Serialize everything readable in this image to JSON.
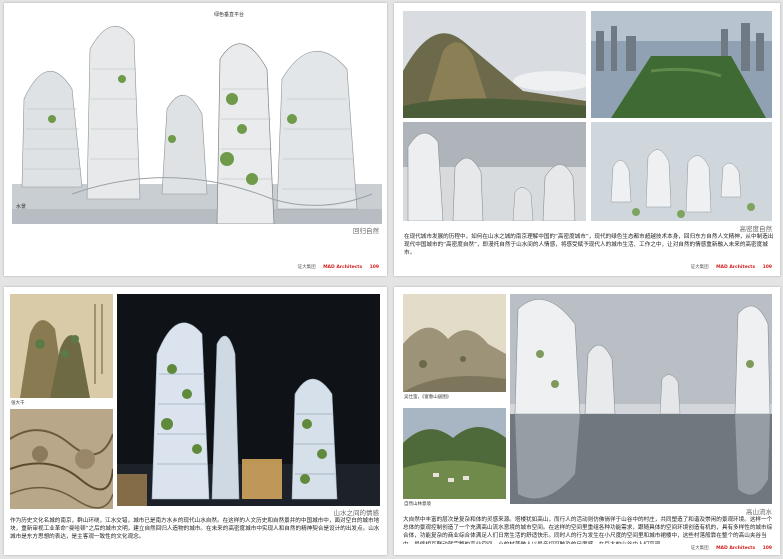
{
  "page1": {
    "annotation_top": "绿色垂直平台",
    "annotation_water": "水景",
    "caption": "回归自然",
    "footer": {
      "corp": "证大集团",
      "brand": "MAD Architects",
      "page": "109"
    }
  },
  "page2": {
    "caption": "高密度自然",
    "body": "在现代城市发展的历程中，如何在山水之城的南京理解中国的“高密度城市”，现代的绿色生态都市超越技术本身，回归东方自然人文精神，从中制造出现代中国城市的“高密度自然”，即漫托自然于山水间的人情感，将感受赋予现代人的城市生活、工作之中，让对自然的情感重新融入未来的高密度城市。",
    "footer": {
      "corp": "证大集团",
      "brand": "MAD Architects",
      "page": "109"
    }
  },
  "page3": {
    "artist_label": "张大千",
    "caption": "山水之间的情感",
    "body": "作为历史文化名城的南京，群山环绕，江水交错，城市已是南方水乡的现代山水自然。在这样的人文历史和自然景并的中国城市中，面对空白的城市地块，重新审视工业革命“曼哈顿”之后的城市文明，建立自然回归人造物的城市。在未来的高密度城市中实现人和自然的精神契合是设计的出发点。山水城市是东方思想的表达，是主客观一致性的文化观念。"
  },
  "page4": {
    "painting_label": "吴仕蛮，《富春山居图》",
    "photo_label": "自然山林意境",
    "caption": "高山流水",
    "body": "大自然中丰富的层次是复杂和体的灵感来源。塔楼犹如高山，而行人的活动则仿佛徜徉于山谷中的村庄，共同塑造了和谐及崇闲的景观环境。这样一个总体的景观控制创造了一个充满高山流水意境的城市空间。在这样的空间里重组各种功能需求，跟随具体的空间环境创造有机的，具有多样性的城市综合体，功能复杂的商业综合体满足人们日常生活的舒适快乐。同时人的行为发生在小尺度的空间里和城市裙楼中，这些村落般靠在整个的高山夹谷当中，最终相互联动就完整的高业空间，小的村落做人以最亲切可触及的尺度感，在巨大的山谷中人们享现",
    "footer": {
      "corp": "证大集团",
      "brand": "MAD Architects",
      "page": "109"
    }
  }
}
